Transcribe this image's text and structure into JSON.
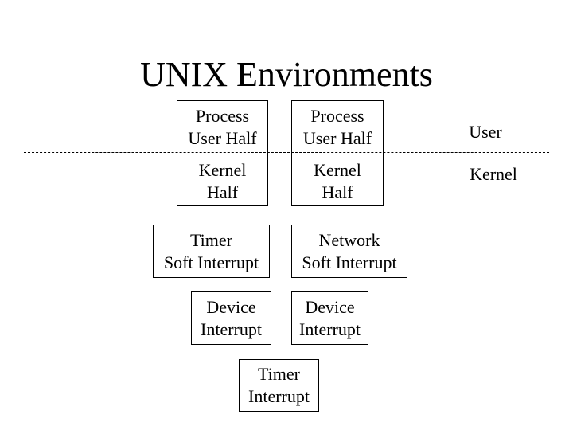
{
  "title": "UNIX Environments",
  "boundary": {
    "user_label": "User",
    "kernel_label": "Kernel"
  },
  "processes": [
    {
      "user_half": [
        "Process",
        "User Half"
      ],
      "kernel_half": [
        "Kernel",
        "Half"
      ]
    },
    {
      "user_half": [
        "Process",
        "User Half"
      ],
      "kernel_half": [
        "Kernel",
        "Half"
      ]
    }
  ],
  "soft_interrupts": [
    {
      "lines": [
        "Timer",
        "Soft Interrupt"
      ]
    },
    {
      "lines": [
        "Network",
        "Soft Interrupt"
      ]
    }
  ],
  "device_interrupts": [
    {
      "lines": [
        "Device",
        "Interrupt"
      ]
    },
    {
      "lines": [
        "Device",
        "Interrupt"
      ]
    }
  ],
  "timer_interrupt": {
    "lines": [
      "Timer",
      "Interrupt"
    ]
  }
}
